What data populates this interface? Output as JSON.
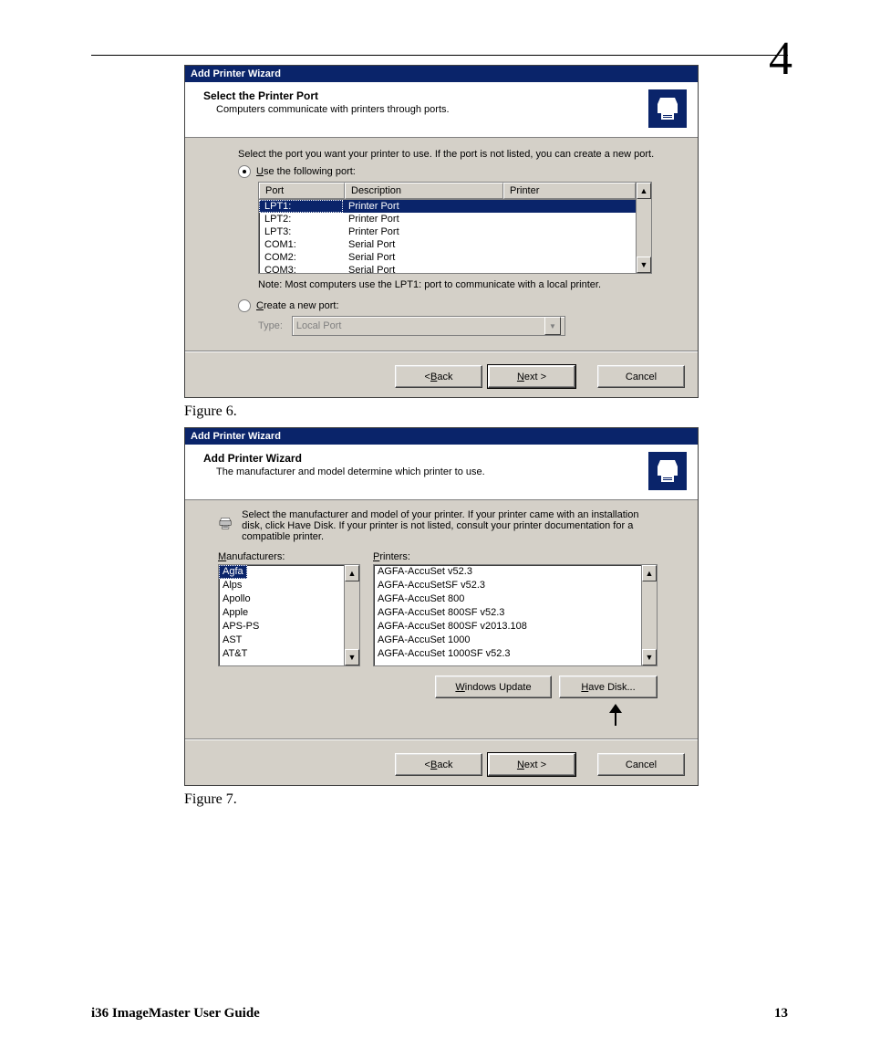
{
  "page": {
    "chapter_number": "4",
    "footer_left": "i36 ImageMaster User Guide",
    "footer_right": "13",
    "fig6_label": "Figure 6.",
    "fig7_label": "Figure 7."
  },
  "wiz1": {
    "titlebar": "Add Printer Wizard",
    "banner_title": "Select the Printer Port",
    "banner_sub": "Computers communicate with printers through ports.",
    "instr": "Select the port you want your printer to use.  If the port is not listed, you can create a new port.",
    "radio_use_prefix": "U",
    "radio_use_rest": "se the following port:",
    "th_port": "Port",
    "th_desc": "Description",
    "th_prn": "Printer",
    "ports": [
      {
        "port": "LPT1:",
        "desc": "Printer Port",
        "printer": ""
      },
      {
        "port": "LPT2:",
        "desc": "Printer Port",
        "printer": ""
      },
      {
        "port": "LPT3:",
        "desc": "Printer Port",
        "printer": ""
      },
      {
        "port": "COM1:",
        "desc": "Serial Port",
        "printer": ""
      },
      {
        "port": "COM2:",
        "desc": "Serial Port",
        "printer": ""
      },
      {
        "port": "COM3:",
        "desc": "Serial Port",
        "printer": ""
      }
    ],
    "selected_port_index": 0,
    "note": "Note: Most computers use the LPT1: port to communicate with a local printer.",
    "radio_create_prefix": "C",
    "radio_create_rest": "reate a new port:",
    "type_label": "Type:",
    "type_value": "Local Port",
    "btn_back_pre": "< ",
    "btn_back_u": "B",
    "btn_back_post": "ack",
    "btn_next_u": "N",
    "btn_next_post": "ext >",
    "btn_cancel": "Cancel"
  },
  "wiz2": {
    "titlebar": "Add Printer Wizard",
    "banner_title": "Add Printer Wizard",
    "banner_sub": "The manufacturer and model determine which printer to use.",
    "desc": "Select the manufacturer and model of your printer. If your printer came with an installation disk, click Have Disk. If your printer is not listed, consult your printer documentation for a compatible printer.",
    "mfr_label_u": "M",
    "mfr_label_rest": "anufacturers:",
    "prn_label_u": "P",
    "prn_label_rest": "rinters:",
    "manufacturers": [
      "Agfa",
      "Alps",
      "Apollo",
      "Apple",
      "APS-PS",
      "AST",
      "AT&T"
    ],
    "selected_mfr_index": 0,
    "printers": [
      "AGFA-AccuSet v52.3",
      "AGFA-AccuSetSF v52.3",
      "AGFA-AccuSet 800",
      "AGFA-AccuSet 800SF v52.3",
      "AGFA-AccuSet 800SF v2013.108",
      "AGFA-AccuSet 1000",
      "AGFA-AccuSet 1000SF v52.3"
    ],
    "btn_winupd_u": "W",
    "btn_winupd_rest": "indows Update",
    "btn_havedisk_u": "H",
    "btn_havedisk_rest": "ave Disk...",
    "btn_back_pre": "< ",
    "btn_back_u": "B",
    "btn_back_post": "ack",
    "btn_next_u": "N",
    "btn_next_post": "ext >",
    "btn_cancel": "Cancel"
  }
}
